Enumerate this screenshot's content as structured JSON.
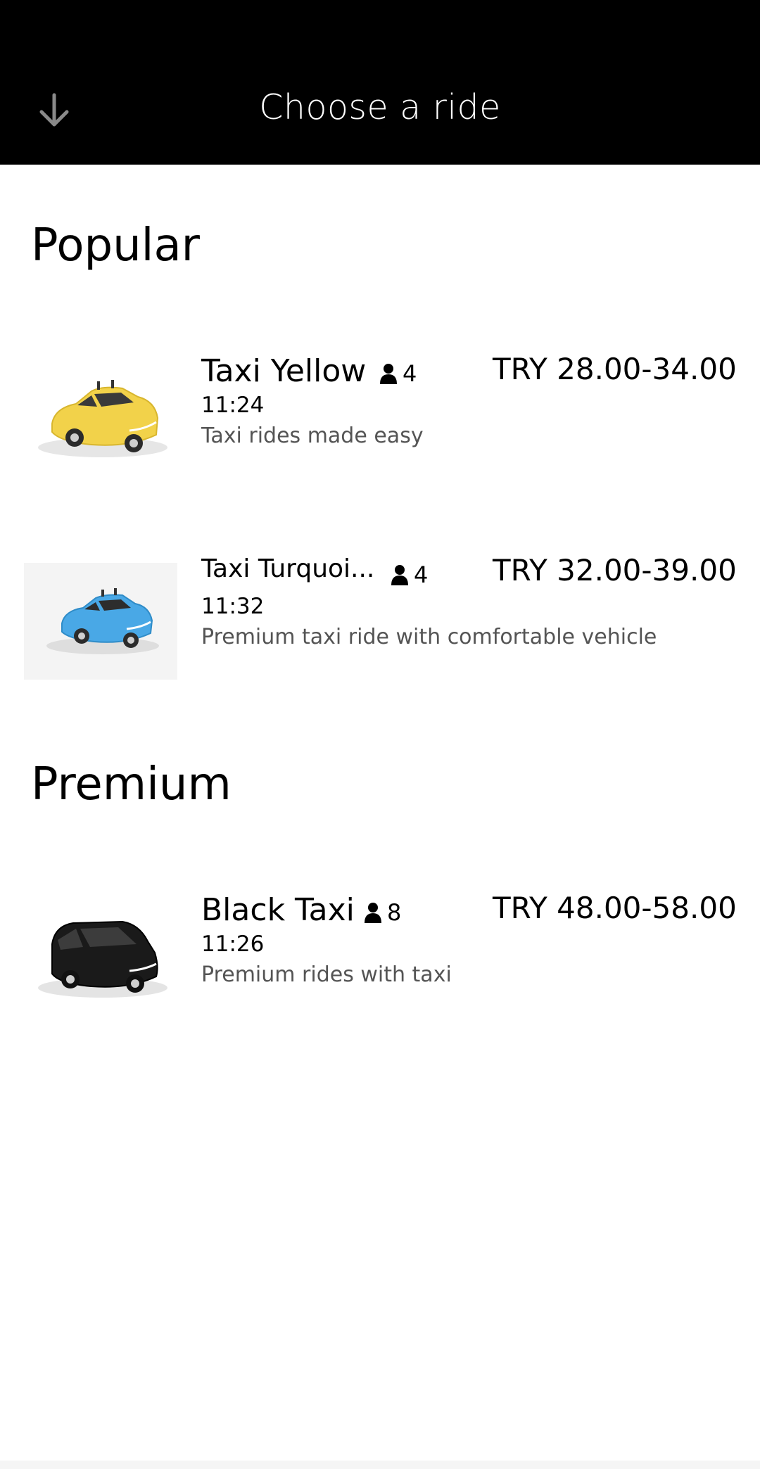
{
  "header": {
    "title": "Choose a ride",
    "back_icon": "arrow-down-icon"
  },
  "sections": [
    {
      "title": "Popular",
      "rides": [
        {
          "name": "Taxi Yellow",
          "capacity": "4",
          "eta": "11:24",
          "description": "Taxi rides made easy",
          "price": "TRY 28.00-34.00",
          "car_color": "#f2d24a"
        },
        {
          "name": "Taxi Turquoi...",
          "capacity": "4",
          "eta": "11:32",
          "description": "Premium taxi ride with comfortable vehicle",
          "price": "TRY 32.00-39.00",
          "car_color": "#49a8e6"
        }
      ]
    },
    {
      "title": "Premium",
      "rides": [
        {
          "name": "Black Taxi",
          "capacity": "8",
          "eta": "11:26",
          "description": "Premium rides with taxi",
          "price": "TRY 48.00-58.00",
          "car_color": "#1a1a1a"
        }
      ]
    }
  ]
}
